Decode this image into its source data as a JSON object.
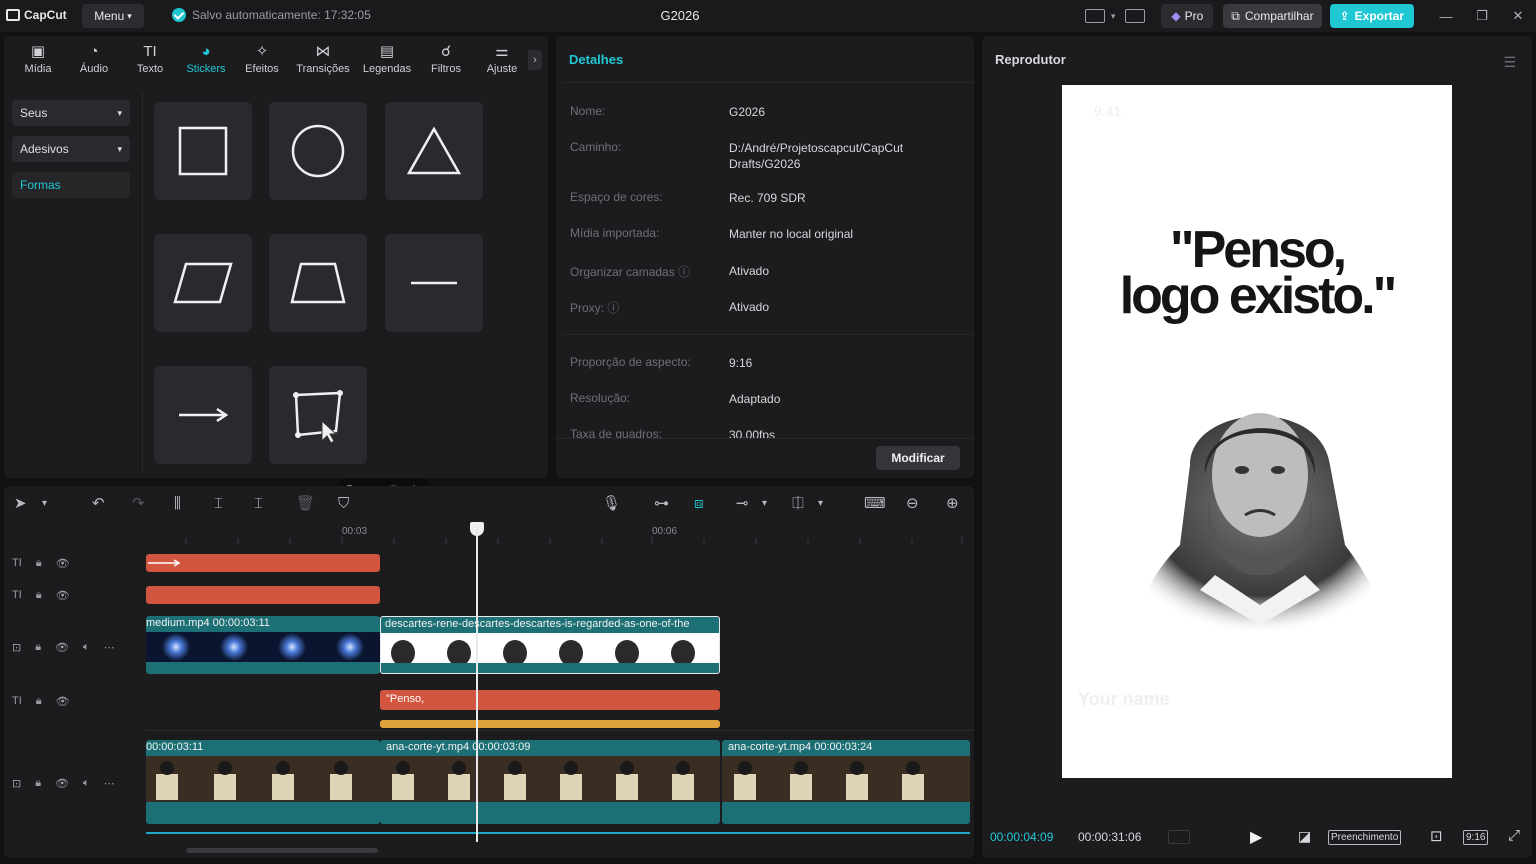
{
  "app": {
    "logo_text": "CapCut",
    "menu_label": "Menu",
    "save_status": "Salvo automaticamente: 17:32:05",
    "project_title": "G2026",
    "pro_label": "Pro",
    "share_label": "Compartilhar",
    "export_label": "Exportar",
    "accent_color": "#20c8d4"
  },
  "tools": [
    {
      "label": "Mídia",
      "icon": "media-icon"
    },
    {
      "label": "Áudio",
      "icon": "audio-icon"
    },
    {
      "label": "Texto",
      "icon": "text-icon"
    },
    {
      "label": "Stickers",
      "icon": "stickers-icon",
      "active": true
    },
    {
      "label": "Efeitos",
      "icon": "effects-icon"
    },
    {
      "label": "Transições",
      "icon": "transitions-icon"
    },
    {
      "label": "Legendas",
      "icon": "captions-icon"
    },
    {
      "label": "Filtros",
      "icon": "filters-icon"
    },
    {
      "label": "Ajuste",
      "icon": "adjust-icon"
    }
  ],
  "stickers_sidebar": {
    "items": [
      "Seus",
      "Adesivos",
      "Formas"
    ],
    "selected": "Formas"
  },
  "shapes": {
    "names": [
      "square",
      "circle",
      "triangle",
      "parallelogram",
      "trapezoid",
      "line",
      "arrow",
      "custom"
    ],
    "tooltip": "Personalizado"
  },
  "details": {
    "title": "Detalhes",
    "rows": [
      {
        "label": "Nome:",
        "value": "G2026"
      },
      {
        "label": "Caminho:",
        "value": "D:/André/Projetoscapcut/CapCut Drafts/G2026"
      },
      {
        "label": "Espaço de cores:",
        "value": "Rec. 709 SDR"
      },
      {
        "label": "Mídia importada:",
        "value": "Manter no local original"
      },
      {
        "label": "Organizar camadas",
        "value": "Ativado"
      },
      {
        "label": "Proxy:",
        "value": "Ativado"
      },
      {
        "label": "Proporção de aspecto:",
        "value": "9:16"
      },
      {
        "label": "Resolução:",
        "value": "Adaptado"
      },
      {
        "label": "Taxa de quadros:",
        "value": "30.00fps"
      }
    ],
    "modify_label": "Modificar"
  },
  "player": {
    "title": "Reprodutor",
    "quote_line1": "\"Penso,",
    "quote_line2": "logo existo.\"",
    "ghost_name": "Your name",
    "current_time": "00:00:04:09",
    "total_time": "00:00:31:06",
    "fill_label": "Preenchimento",
    "ratio_label": "9:16"
  },
  "timeline": {
    "ruler": [
      "00:03",
      "00:06"
    ],
    "clips": {
      "video1_a": "medium.mp4  00:00:03:11",
      "video1_b": "descartes-rene-descartes-descartes-is-regarded-as-one-of-the",
      "text_clip": "\"Penso,",
      "main_a": "00:00:03:11",
      "main_b": "ana-corte-yt.mp4  00:00:03:09",
      "main_c": "ana-corte-yt.mp4  00:00:03:24"
    }
  }
}
